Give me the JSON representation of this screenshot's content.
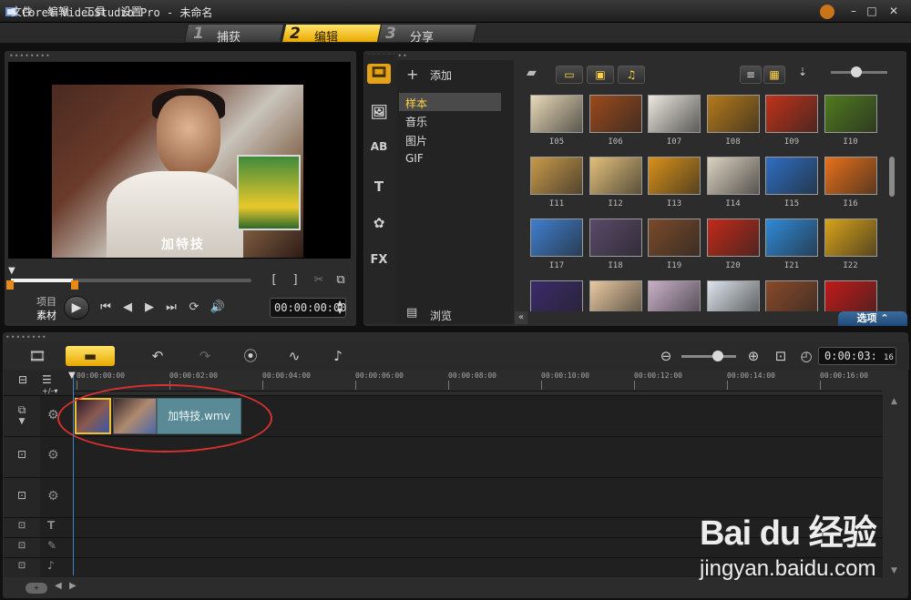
{
  "window": {
    "title": "Corel VideoStudio Pro - 未命名",
    "min": "–",
    "max": "□",
    "close": "✕"
  },
  "menu": [
    "文件",
    "编辑",
    "工具",
    "设置"
  ],
  "steps": [
    {
      "num": "1",
      "label": "捕获"
    },
    {
      "num": "2",
      "label": "编辑"
    },
    {
      "num": "3",
      "label": "分享"
    }
  ],
  "player": {
    "subtitle": "加特技",
    "mode_project": "项目",
    "mode_clip": "素材",
    "timecode": "00:00:00:00",
    "controls": {
      "play": "▶",
      "home": "⏮",
      "prev": "◀",
      "next": "▶",
      "end": "⏭",
      "repeat": "⟳",
      "volume": "🔊",
      "mark_in": "[",
      "mark_out": "]"
    }
  },
  "library": {
    "add_label": "添加",
    "folders": [
      "样本",
      "音乐",
      "图片",
      "GIF"
    ],
    "browse_label": "浏览",
    "options_label": "选项",
    "side_icons": [
      "🎞",
      "🖼",
      "AB",
      "T",
      "✿",
      "FX"
    ],
    "thumbs": [
      {
        "label": "I05",
        "color": "#e8d9b8"
      },
      {
        "label": "I06",
        "color": "#9a4a1c"
      },
      {
        "label": "I07",
        "color": "#ece8df"
      },
      {
        "label": "I08",
        "color": "#b57a1a"
      },
      {
        "label": "I09",
        "color": "#c0321a"
      },
      {
        "label": "I10",
        "color": "#4f7a1e"
      },
      {
        "label": "I11",
        "color": "#c89a4a"
      },
      {
        "label": "I12",
        "color": "#e2c07a"
      },
      {
        "label": "I13",
        "color": "#d8901a"
      },
      {
        "label": "I14",
        "color": "#dcd2c0"
      },
      {
        "label": "I15",
        "color": "#2e6ec2"
      },
      {
        "label": "I16",
        "color": "#e8701a"
      },
      {
        "label": "I17",
        "color": "#3f7fd0"
      },
      {
        "label": "I18",
        "color": "#5a4a6a"
      },
      {
        "label": "I19",
        "color": "#7a4a2a"
      },
      {
        "label": "I20",
        "color": "#c22a1a"
      },
      {
        "label": "I21",
        "color": "#2f8ad8"
      },
      {
        "label": "I22",
        "color": "#d8a21a"
      },
      {
        "label": "",
        "color": "#3a2a6a"
      },
      {
        "label": "",
        "color": "#e8c8a0"
      },
      {
        "label": "",
        "color": "#c8b0c8"
      },
      {
        "label": "",
        "color": "#dde4ec"
      },
      {
        "label": "",
        "color": "#8a4a2a"
      },
      {
        "label": "",
        "color": "#c21a1a"
      }
    ]
  },
  "timeline": {
    "timecode_main": "0:00:03:",
    "timecode_frames": "16",
    "clip_name": "加特技.wmv",
    "ticks": [
      "00:00:00:00",
      "00:00:02:00",
      "00:00:04:00",
      "00:00:06:00",
      "00:00:08:00",
      "00:00:10:00",
      "00:00:12:00",
      "00:00:14:00",
      "00:00:16:00"
    ]
  },
  "watermark": {
    "logo": "Bai du 经验",
    "url": "jingyan.baidu.com"
  }
}
